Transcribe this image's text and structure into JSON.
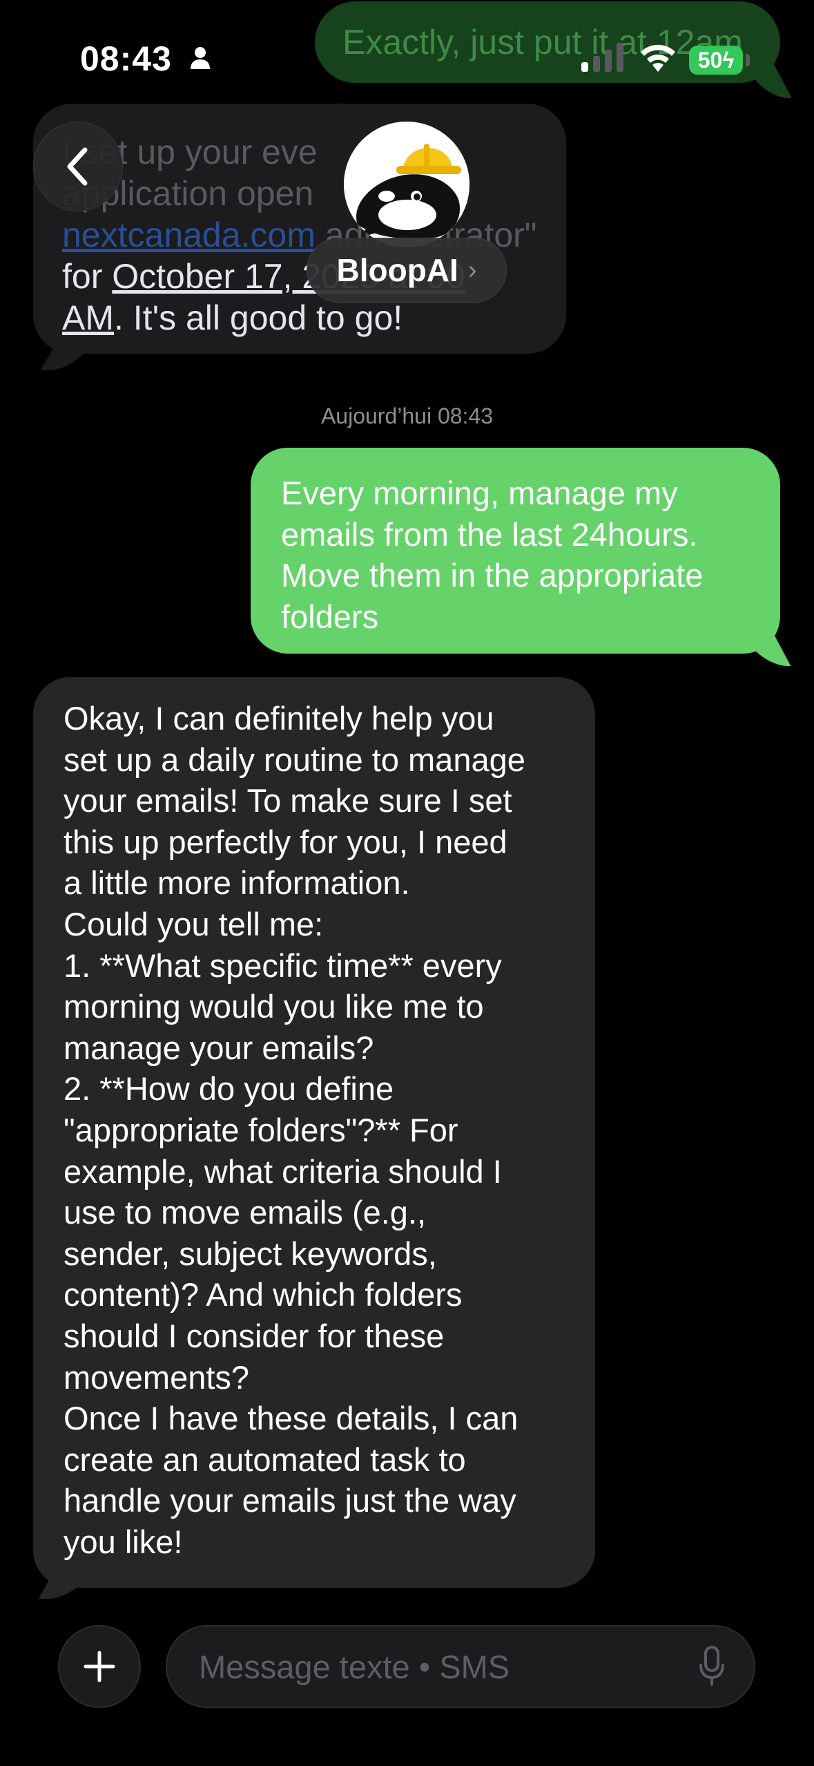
{
  "status_bar": {
    "time": "08:43",
    "battery": "50"
  },
  "previous_messages": {
    "outgoing_text": "Exactly, just put it at 12am",
    "incoming_lines": {
      "line1": "I set up your eve",
      "line2": "application open",
      "link": "nextcanada.com",
      "line3_suffix": " administrator\"",
      "line4_prefix": "for ",
      "line4_date": "October 17, 2025 at 00",
      "line5_am": "AM",
      "line5_rest": ". It's all good to go!"
    }
  },
  "header": {
    "contact_name": "BloopAI",
    "chevron": "›"
  },
  "conversation": {
    "timestamp": "Aujourd’hui 08:43",
    "outgoing_message": "Every morning, manage my emails from the last 24hours. Move them in the appropriate folders",
    "incoming_message": {
      "lines": [
        "Okay, I can definitely help you",
        "set up a daily routine to manage",
        "your emails! To make sure I set",
        "this up perfectly for you, I need",
        "a little more information.",
        "Could you tell me:",
        "1. **What specific time** every",
        "morning would you like me to",
        "manage your emails?",
        "2. **How do you define",
        "\"appropriate folders\"?** For",
        "example, what criteria should I",
        "use to move emails (e.g.,",
        "sender, subject keywords,",
        "content)? And which folders",
        "should I consider for these",
        "movements?",
        "Once I have these details, I can",
        "create an automated task to",
        "handle your emails just the way",
        "you like!"
      ]
    }
  },
  "compose": {
    "placeholder": "Message texte • SMS"
  },
  "colors": {
    "outgoing_bubble": "#65d26a",
    "incoming_bubble": "#262628",
    "background": "#000000"
  }
}
